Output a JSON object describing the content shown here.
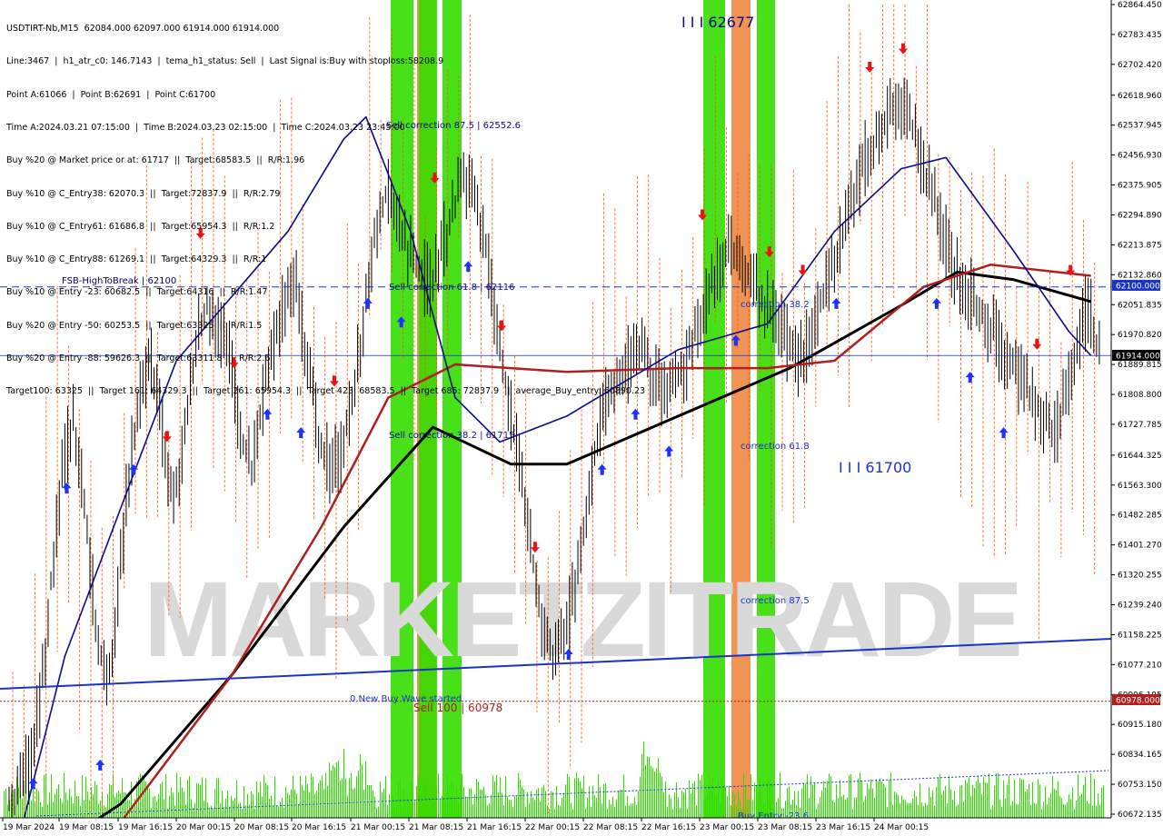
{
  "header_lines": [
    "USDTIRT-Nb,M15  62084.000 62097.000 61914.000 61914.000",
    "Line:3467  |  h1_atr_c0: 146.7143  |  tema_h1_status: Sell  |  Last Signal is:Buy with stoploss:58208.9",
    "Point A:61066  |  Point B:62691  |  Point C:61700",
    "Time A:2024.03.21 07:15:00  |  Time B:2024.03.23 02:15:00  |  Time C:2024.03.23 23:45:00",
    "Buy %20 @ Market price or at: 61717  ||  Target:68583.5  ||  R/R:1.96",
    "Buy %10 @ C_Entry38: 62070.3  ||  Target:72837.9  ||  R/R:2.79",
    "Buy %10 @ C_Entry61: 61686.8  ||  Target:65954.3  ||  R/R:1.2",
    "Buy %10 @ C_Entry88: 61269.1  ||  Target:64329.3  ||  R/R:1",
    "Buy %10 @ Entry -23: 60682.5  ||  Target:64316  ||  R/R:1.47",
    "Buy %20 @ Entry -50: 60253.5  ||  Target:63325  ||  R/R:1.5",
    "Buy %20 @ Entry -88: 59626.3  ||  Target:63311.8  ||  R/R:2.6",
    "Target100: 63325  ||  Target 161: 64329.3  ||  Target 261: 65954.3  ||  Target 423: 68583.5  ||  Target 685: 72837.9  ||  average_Buy_entry: 60890.23"
  ],
  "watermark": "MARKETZITRADE",
  "price_boxes": {
    "fsb": "62100.000",
    "current": "61914.000",
    "sell100": "60978.000"
  },
  "colors": {
    "bull_band": "#33dd00",
    "bear_band": "#ee8844",
    "buy_arrow": "#1a33ff",
    "sell_arrow": "#ee1111",
    "black_ma": "#000000",
    "red_ma": "#b01e1e",
    "navy_ma": "#0a0a8c",
    "envelope": "#ff5500",
    "volume": "#33dd00",
    "trendline": "#1a33cc"
  },
  "chart_data": {
    "type": "candlestick",
    "symbol": "USDTIRT-Nb",
    "timeframe": "M15",
    "ohlc_last": {
      "open": 62084.0,
      "high": 62097.0,
      "low": 61914.0,
      "close": 61914.0
    },
    "ylim": [
      60672.135,
      62864.45
    ],
    "y_ticks": [
      "62864.450",
      "62783.435",
      "62702.420",
      "62618.960",
      "62537.945",
      "62456.930",
      "62375.905",
      "62294.890",
      "62213.875",
      "62132.860",
      "62051.835",
      "61970.820",
      "61889.815",
      "61808.800",
      "61727.785",
      "61644.325",
      "61563.300",
      "61482.285",
      "61401.270",
      "61320.255",
      "61239.240",
      "61158.225",
      "61077.210",
      "60996.195",
      "60915.180",
      "60834.165",
      "60753.150",
      "60672.135"
    ],
    "x_ticks": [
      "19 Mar 2024",
      "19 Mar 08:15",
      "19 Mar 16:15",
      "20 Mar 00:15",
      "20 Mar 08:15",
      "20 Mar 16:15",
      "21 Mar 00:15",
      "21 Mar 08:15",
      "21 Mar 16:15",
      "22 Mar 00:15",
      "22 Mar 08:15",
      "22 Mar 16:15",
      "23 Mar 00:15",
      "23 Mar 08:15",
      "23 Mar 16:15",
      "24 Mar 00:15"
    ],
    "bars_closes_approx": [
      60720,
      60800,
      60950,
      61300,
      61600,
      61750,
      61500,
      61200,
      61000,
      61250,
      61600,
      61800,
      61900,
      61700,
      61500,
      61700,
      61950,
      62050,
      62000,
      61900,
      61700,
      61600,
      61800,
      61950,
      62050,
      62100,
      61900,
      61700,
      61600,
      61650,
      61800,
      62000,
      62250,
      62350,
      62300,
      62200,
      62150,
      62100,
      62200,
      62300,
      62400,
      62350,
      62200,
      62000,
      61800,
      61600,
      61400,
      61200,
      61100,
      61150,
      61300,
      61500,
      61700,
      61800,
      61850,
      61900,
      61950,
      61850,
      61800,
      61850,
      61900,
      62000,
      62100,
      62150,
      62200,
      62150,
      62100,
      62050,
      62000,
      61950,
      61900,
      61950,
      62050,
      62150,
      62250,
      62350,
      62450,
      62500,
      62550,
      62600,
      62550,
      62450,
      62350,
      62250,
      62150,
      62100,
      62050,
      62000,
      61950,
      61900,
      61850,
      61800,
      61750,
      61700,
      61800,
      61950,
      62050,
      61914
    ],
    "horizontal_levels": [
      {
        "label": "FSB-HighToBreak | 62100",
        "value": 62100
      },
      {
        "label": "Sell correction 87.5 | 62552.6",
        "value": 62552.6
      },
      {
        "label": "Sell correction 61.8 | 62116",
        "value": 62116
      },
      {
        "label": "Sell correction 38.2 | 61715",
        "value": 61715
      },
      {
        "label": "Sell 100 | 60978",
        "value": 60978
      },
      {
        "label": "0 New Buy Wave started",
        "value": 60978
      }
    ],
    "annotations": [
      {
        "text": "I I I 62677",
        "value": 62677
      },
      {
        "text": "I I I 61700",
        "value": 61700
      },
      {
        "text": "correction 38.2",
        "value": 62070
      },
      {
        "text": "correction 61.8",
        "value": 61686
      },
      {
        "text": "correction 87.5",
        "value": 61269
      },
      {
        "text": "Buy Entry -23.6",
        "value": 60682
      }
    ],
    "moving_averages": [
      {
        "name": "black",
        "points": [
          [
            0,
            60500
          ],
          [
            10,
            60700
          ],
          [
            20,
            61050
          ],
          [
            30,
            61450
          ],
          [
            38,
            61720
          ],
          [
            45,
            61620
          ],
          [
            50,
            61620
          ],
          [
            60,
            61750
          ],
          [
            70,
            61880
          ],
          [
            80,
            62050
          ],
          [
            85,
            62140
          ],
          [
            90,
            62120
          ],
          [
            97,
            62060
          ]
        ]
      },
      {
        "name": "red",
        "points": [
          [
            0,
            60500
          ],
          [
            10,
            60650
          ],
          [
            20,
            61050
          ],
          [
            28,
            61450
          ],
          [
            34,
            61800
          ],
          [
            40,
            61890
          ],
          [
            50,
            61870
          ],
          [
            60,
            61880
          ],
          [
            68,
            61880
          ],
          [
            74,
            61900
          ],
          [
            82,
            62100
          ],
          [
            88,
            62160
          ],
          [
            97,
            62130
          ]
        ]
      },
      {
        "name": "navy",
        "points": [
          [
            0,
            60500
          ],
          [
            5,
            61100
          ],
          [
            15,
            61900
          ],
          [
            25,
            62250
          ],
          [
            30,
            62500
          ],
          [
            32,
            62560
          ],
          [
            36,
            62250
          ],
          [
            40,
            61800
          ],
          [
            44,
            61680
          ],
          [
            50,
            61750
          ],
          [
            60,
            61930
          ],
          [
            68,
            62000
          ],
          [
            74,
            62250
          ],
          [
            80,
            62420
          ],
          [
            84,
            62450
          ],
          [
            90,
            62200
          ],
          [
            95,
            61980
          ],
          [
            97,
            61914
          ]
        ]
      }
    ]
  }
}
